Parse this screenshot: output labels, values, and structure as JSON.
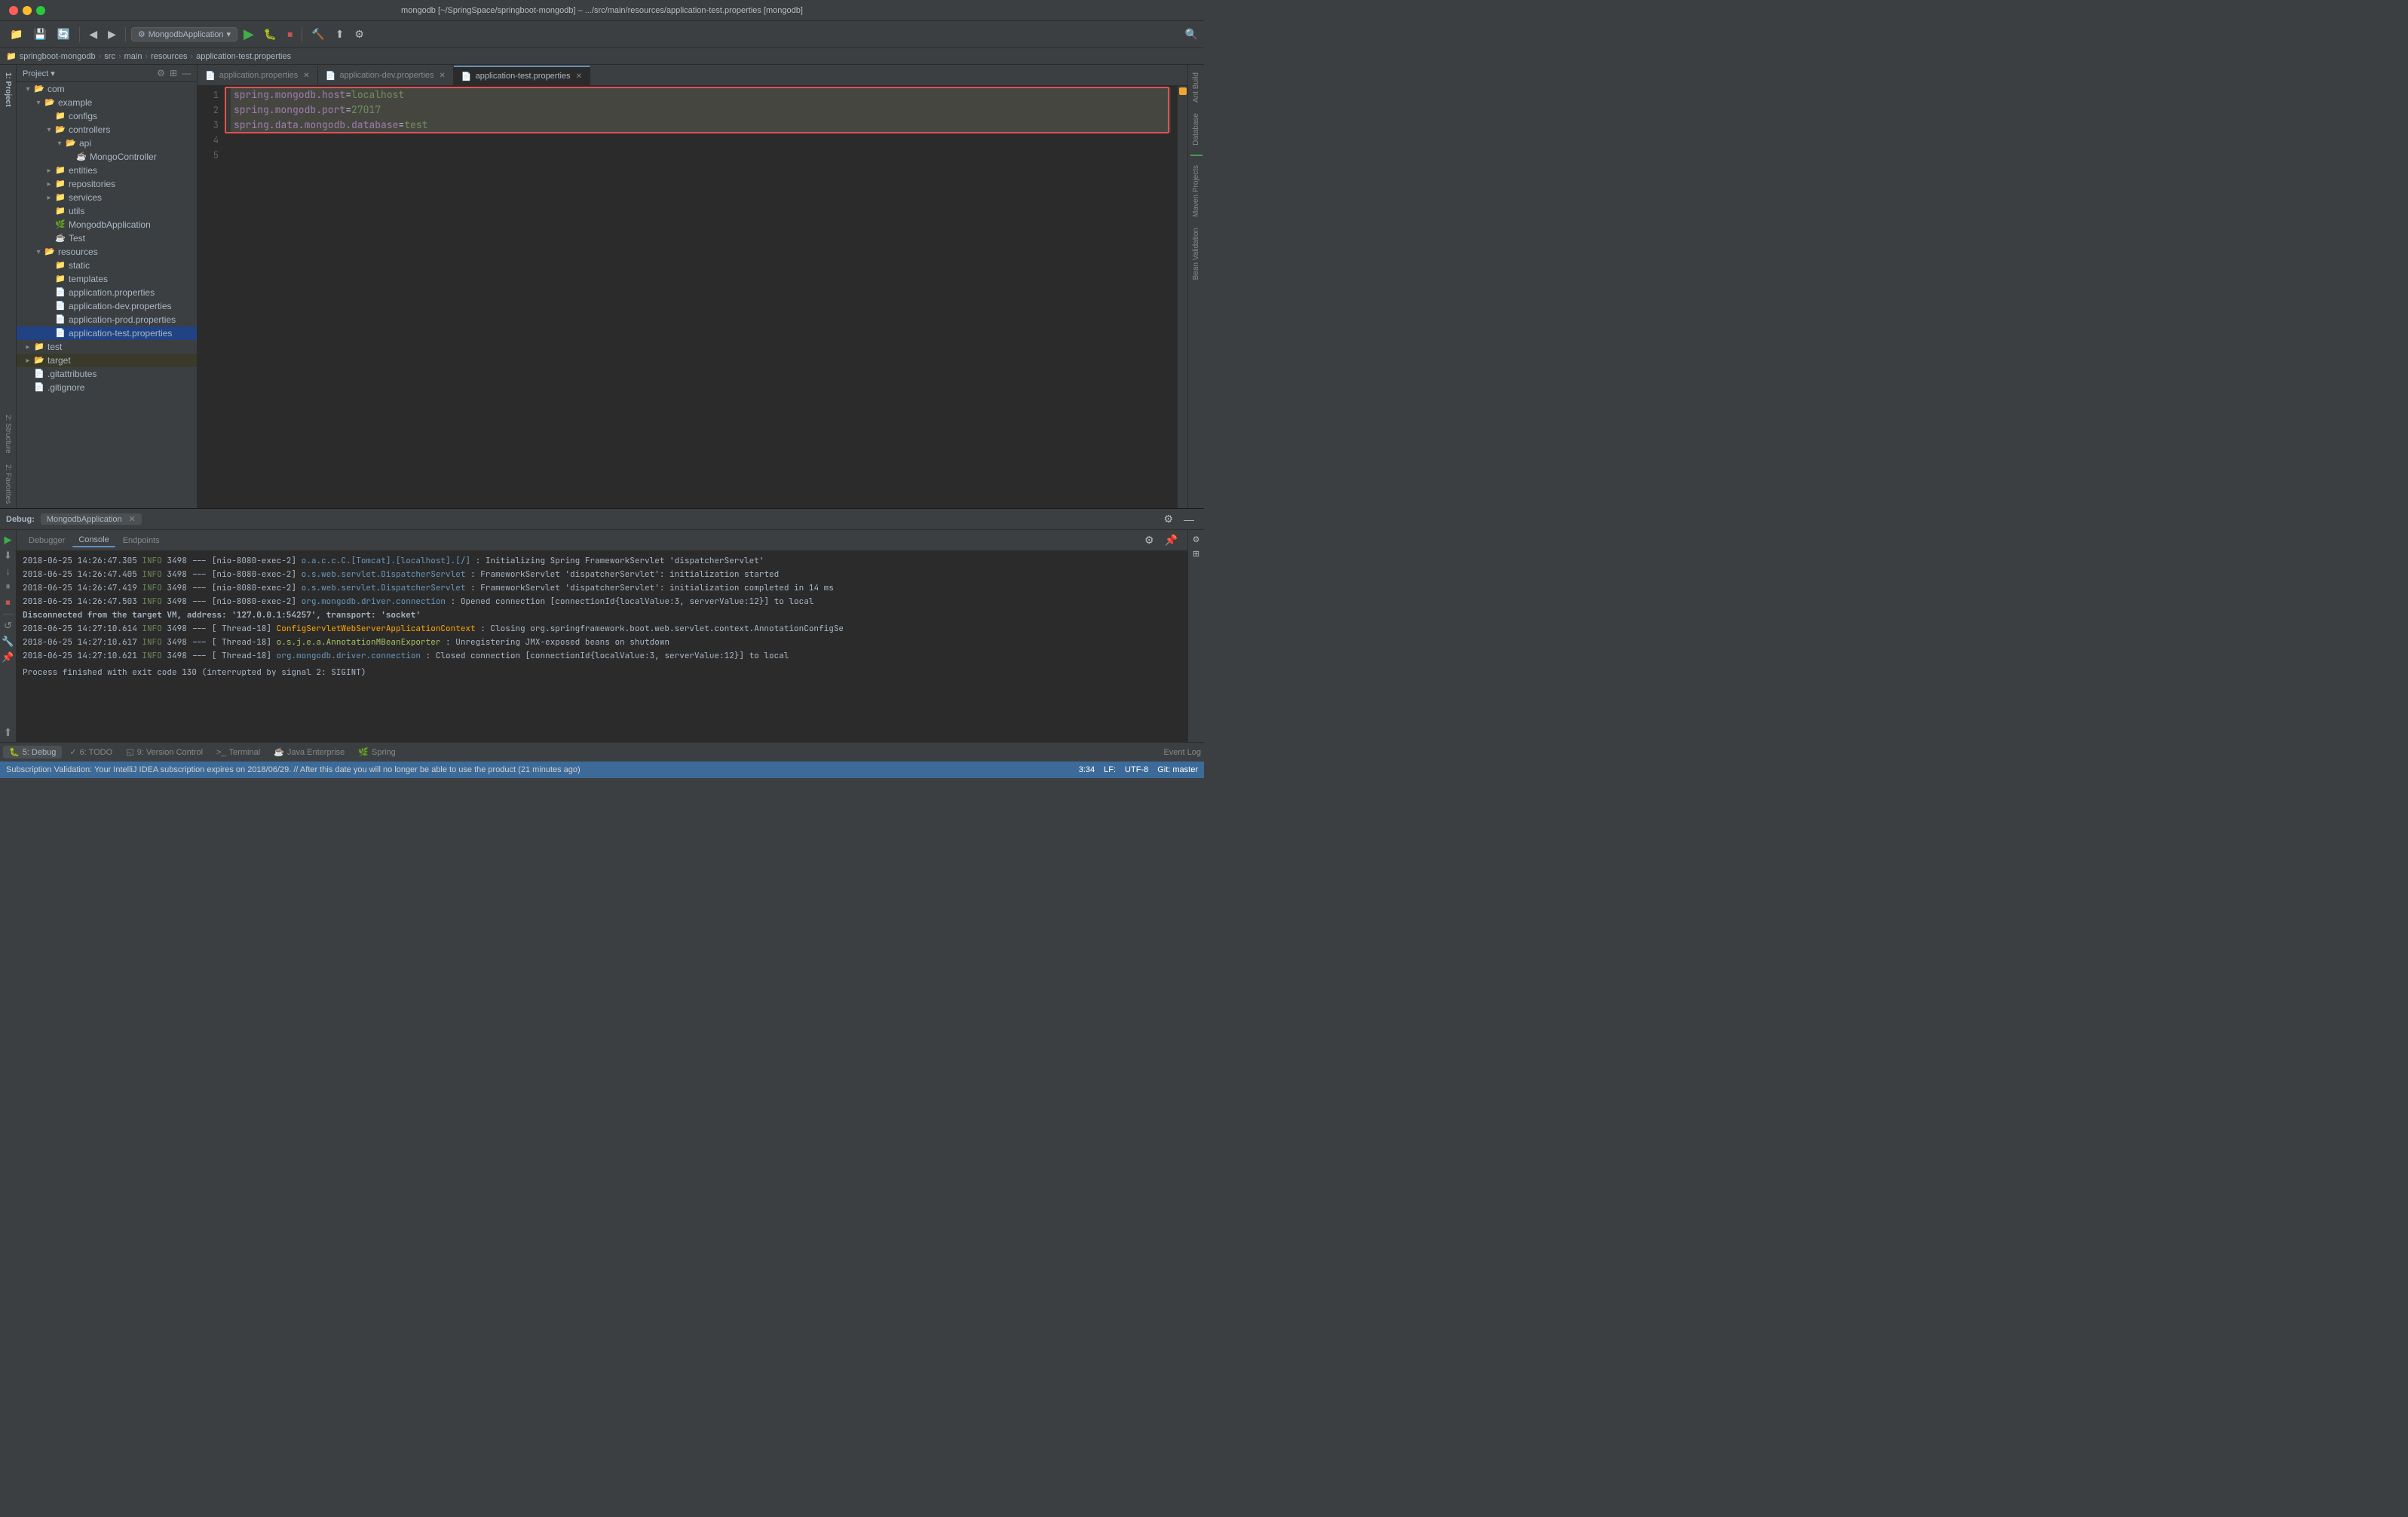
{
  "titleBar": {
    "title": "mongodb [~/SpringSpace/springboot-mongodb] – .../src/main/resources/application-test.properties [mongodb]"
  },
  "breadcrumb": {
    "items": [
      "springboot-mongodb",
      "src",
      "main",
      "resources",
      "application-test.properties"
    ]
  },
  "sidebar": {
    "header": "Project",
    "items": [
      {
        "level": 1,
        "type": "folder-open",
        "label": "com",
        "hasArrow": true,
        "expanded": true
      },
      {
        "level": 2,
        "type": "folder-open",
        "label": "example",
        "hasArrow": true,
        "expanded": true
      },
      {
        "level": 3,
        "type": "folder",
        "label": "configs",
        "hasArrow": false
      },
      {
        "level": 3,
        "type": "folder-open",
        "label": "controllers",
        "hasArrow": true,
        "expanded": true
      },
      {
        "level": 4,
        "type": "folder-open",
        "label": "api",
        "hasArrow": true,
        "expanded": true
      },
      {
        "level": 5,
        "type": "java",
        "label": "MongoController",
        "hasArrow": false
      },
      {
        "level": 3,
        "type": "folder",
        "label": "entities",
        "hasArrow": false
      },
      {
        "level": 3,
        "type": "folder",
        "label": "repositories",
        "hasArrow": false
      },
      {
        "level": 3,
        "type": "folder",
        "label": "services",
        "hasArrow": false
      },
      {
        "level": 3,
        "type": "folder",
        "label": "utils",
        "hasArrow": false
      },
      {
        "level": 3,
        "type": "spring",
        "label": "MongodbApplication",
        "hasArrow": false
      },
      {
        "level": 3,
        "type": "java",
        "label": "Test",
        "hasArrow": false
      },
      {
        "level": 2,
        "type": "folder-open",
        "label": "resources",
        "hasArrow": true,
        "expanded": true
      },
      {
        "level": 3,
        "type": "folder",
        "label": "static",
        "hasArrow": false
      },
      {
        "level": 3,
        "type": "folder",
        "label": "templates",
        "hasArrow": false
      },
      {
        "level": 3,
        "type": "properties",
        "label": "application.properties",
        "hasArrow": false
      },
      {
        "level": 3,
        "type": "properties",
        "label": "application-dev.properties",
        "hasArrow": false
      },
      {
        "level": 3,
        "type": "properties",
        "label": "application-prod.properties",
        "hasArrow": false
      },
      {
        "level": 3,
        "type": "properties-sel",
        "label": "application-test.properties",
        "hasArrow": false,
        "selected": true
      },
      {
        "level": 1,
        "type": "folder",
        "label": "test",
        "hasArrow": true
      },
      {
        "level": 1,
        "type": "folder-open",
        "label": "target",
        "hasArrow": true,
        "highlighted": true
      },
      {
        "level": 1,
        "type": "git",
        "label": ".gitattributes",
        "hasArrow": false
      },
      {
        "level": 1,
        "type": "git",
        "label": ".gitignore",
        "hasArrow": false
      }
    ]
  },
  "tabs": [
    {
      "label": "application.properties",
      "type": "properties",
      "active": false,
      "closable": true
    },
    {
      "label": "application-dev.properties",
      "type": "properties",
      "active": false,
      "closable": true
    },
    {
      "label": "application-test.properties",
      "type": "properties",
      "active": true,
      "closable": true
    }
  ],
  "editor": {
    "lines": [
      {
        "num": 1,
        "content": "spring.mongodb.host=localhost",
        "highlighted": true
      },
      {
        "num": 2,
        "content": "spring.mongodb.port=27017",
        "highlighted": true
      },
      {
        "num": 3,
        "content": "spring.data.mongodb.database=test",
        "highlighted": true
      },
      {
        "num": 4,
        "content": ""
      },
      {
        "num": 5,
        "content": ""
      }
    ]
  },
  "bottomPanel": {
    "title": "Debug:",
    "runConfig": "MongodbApplication",
    "tabs": [
      "Debugger",
      "Console",
      "Endpoints"
    ],
    "activeTab": "Console",
    "logs": [
      {
        "time": "2018-06-25 14:26:47.305",
        "level": "INFO",
        "thread": "3498",
        "executor": "[nio-8080-exec-2]",
        "class": "o.a.c.c.C.[Tomcat].[localhost].[/]",
        "message": ": Initializing Spring FrameworkServlet 'dispatcherServlet'"
      },
      {
        "time": "2018-06-25 14:26:47.405",
        "level": "INFO",
        "thread": "3498",
        "executor": "[nio-8080-exec-2]",
        "class": "o.s.web.servlet.DispatcherServlet",
        "message": ": FrameworkServlet 'dispatcherServlet': initialization started"
      },
      {
        "time": "2018-06-25 14:26:47.419",
        "level": "INFO",
        "thread": "3498",
        "executor": "[nio-8080-exec-2]",
        "class": "o.s.web.servlet.DispatcherServlet",
        "message": ": FrameworkServlet 'dispatcherServlet': initialization completed in 14 ms"
      },
      {
        "time": "2018-06-25 14:26:47.503",
        "level": "INFO",
        "thread": "3498",
        "executor": "[nio-8080-exec-2]",
        "class": "org.mongodb.driver.connection",
        "message": ": Opened connection [connectionId{localValue:3, serverValue:12}] to local"
      },
      {
        "time": "",
        "level": "",
        "thread": "",
        "executor": "",
        "class": "",
        "message": "Disconnected from the target VM, address: '127.0.0.1:54257', transport: 'socket'"
      },
      {
        "time": "2018-06-25 14:27:10.614",
        "level": "INFO",
        "thread": "3498",
        "executor": "[     Thread-18]",
        "class": "ConfigServletWebServerApplicationContext",
        "message": ": Closing org.springframework.boot.web.servlet.context.AnnotationConfigSe"
      },
      {
        "time": "2018-06-25 14:27:10.617",
        "level": "INFO",
        "thread": "3498",
        "executor": "[     Thread-18]",
        "class": "o.s.j.e.a.AnnotationMBeanExporter",
        "message": ": Unregistering JMX-exposed beans on shutdown"
      },
      {
        "time": "2018-06-25 14:27:10.621",
        "level": "INFO",
        "thread": "3498",
        "executor": "[     Thread-18]",
        "class": "org.mongodb.driver.connection",
        "message": ": Closed connection [connectionId{localValue:3, serverValue:12}] to local"
      },
      {
        "time": "",
        "level": "",
        "thread": "",
        "executor": "",
        "class": "",
        "message": "Process finished with exit code 130 (interrupted by signal 2: SIGINT)"
      }
    ]
  },
  "statusBar": {
    "message": "Subscription Validation: Your IntelliJ IDEA subscription expires on 2018/06/29. // After this date you will no longer be able to use the product (21 minutes ago)",
    "position": "3:34",
    "encoding": "LF:",
    "charset": "UTF-8",
    "vcs": "Git: master"
  },
  "footerTabs": [
    {
      "label": "5: Debug",
      "icon": "🐛"
    },
    {
      "label": "6: TODO",
      "icon": "✓"
    },
    {
      "label": "9: Version Control",
      "icon": "◱"
    },
    {
      "label": "Terminal",
      "icon": ">_"
    },
    {
      "label": "Java Enterprise",
      "icon": "☕"
    },
    {
      "label": "Spring",
      "icon": "🌿"
    }
  ],
  "rightPanels": [
    {
      "label": "Ant Build"
    },
    {
      "label": "Database"
    },
    {
      "label": "Maven Projects"
    },
    {
      "label": "Bean Validation"
    }
  ]
}
